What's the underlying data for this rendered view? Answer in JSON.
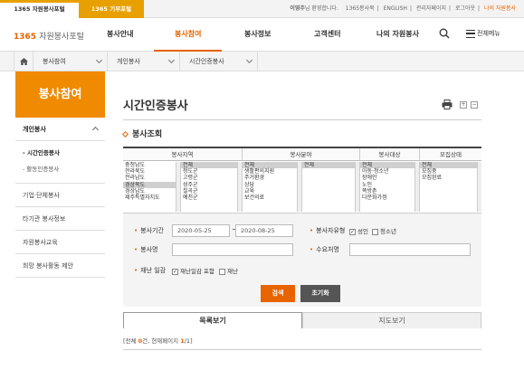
{
  "topbar": {
    "tab1": "1365 자원봉사포털",
    "tab2": "1365 기부포털",
    "welcome_name": "이영주",
    "welcome_suffix": "님 환영합니다.",
    "links": [
      "1365봉사북",
      "ENGLISH",
      "관리자페이지",
      "로그아웃"
    ],
    "my_link": "나의 자원봉사"
  },
  "header": {
    "logo_num": "1365",
    "logo_text": "자원봉사포털",
    "menu": [
      "봉사안내",
      "봉사참여",
      "봉사정보",
      "고객센터",
      "나의 자원봉사"
    ],
    "active_menu": "봉사참여",
    "all_menu": "전체메뉴"
  },
  "breadcrumb": [
    "봉사참여",
    "개인봉사",
    "시간인증봉사"
  ],
  "sidebar": {
    "title": "봉사참여",
    "section": "개인봉사",
    "sub": [
      "- 시간인증봉사",
      "- 활동인증봉사"
    ],
    "items": [
      "기업·단체봉사",
      "타기관 봉사정보",
      "자원봉사교육",
      "희망 봉사활동 제안"
    ]
  },
  "page": {
    "title": "시간인증봉사",
    "zoom_in": "+",
    "zoom_out": "−",
    "section": "봉사조회"
  },
  "filters": {
    "headers": [
      "봉사지역",
      "봉사분야",
      "봉사대상",
      "모집상태"
    ],
    "region": [
      "충청남도",
      "전라북도",
      "전라남도",
      "경상북도",
      "경상남도",
      "제주특별자치도"
    ],
    "region_selected": "경상북도",
    "district": [
      "전체",
      "청도군",
      "고령군",
      "성주군",
      "칠곡군",
      "예천군"
    ],
    "district_selected": "전체",
    "field1": [
      "전체",
      "생활편의지원",
      "주거환경",
      "상담",
      "교육",
      "보건의료"
    ],
    "field1_selected": "전체",
    "field2": [
      "전체"
    ],
    "field2_selected": "전체",
    "target": [
      "전체",
      "아동·청소년",
      "장애인",
      "노인",
      "쪽방촌",
      "다문화가정"
    ],
    "target_selected": "전체",
    "status": [
      "전체",
      "모집중",
      "모집완료"
    ],
    "status_selected": "전체"
  },
  "form": {
    "period_label": "봉사기간",
    "start": "2020-05-25",
    "end": "2020-08-25",
    "tilde": "~",
    "type_label": "봉사자유형",
    "adult": "성인",
    "youth": "청소년",
    "name_label": "봉사명",
    "agency_label": "수요처명",
    "disaster_label": "재난 일감",
    "disaster_incl": "재난일감 포함",
    "disaster_only": "재난",
    "search": "검색",
    "reset": "초기화"
  },
  "tabs": {
    "list": "목록보기",
    "map": "지도보기"
  },
  "result": {
    "prefix": "[전체 ",
    "count": "0",
    "mid": "건, 현재페이지 ",
    "page": "1",
    "sep": "/",
    "pages": "1",
    "suffix": "]"
  }
}
